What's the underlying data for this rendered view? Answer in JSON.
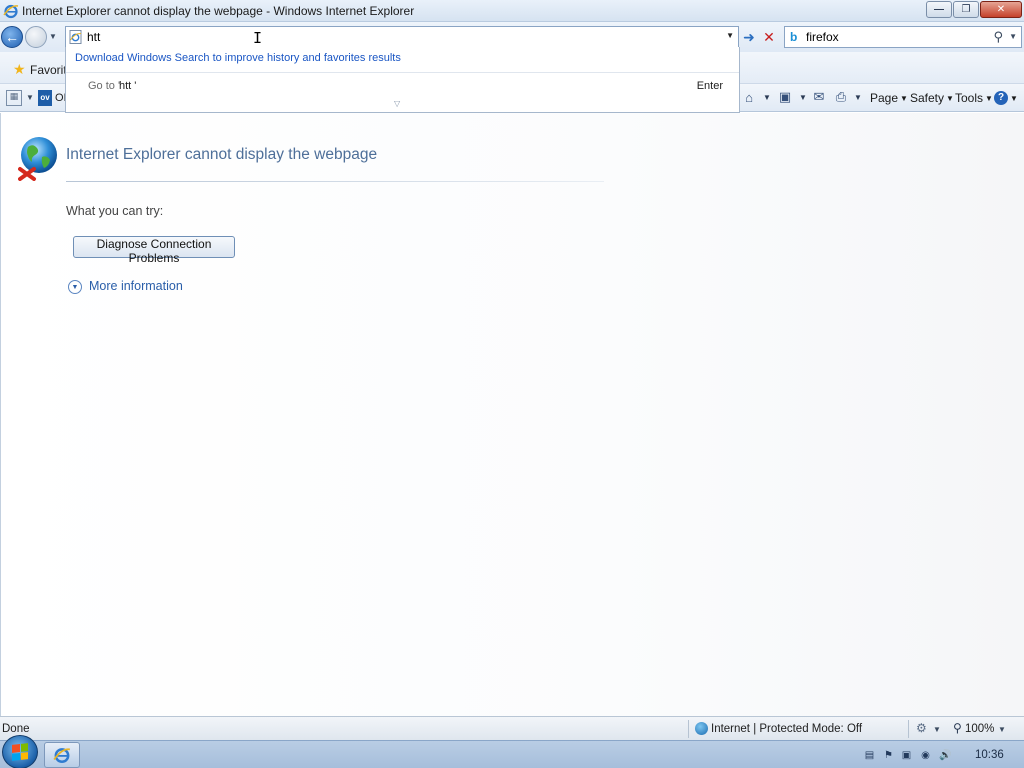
{
  "window": {
    "title": "Internet Explorer cannot display the webpage - Windows Internet Explorer"
  },
  "navbar": {
    "address_value": "htt",
    "search_value": "firefox"
  },
  "address_dropdown": {
    "suggestion_link": "Download Windows Search to improve history and favorites results",
    "goto_label": "Go to '",
    "goto_value": "htt '",
    "enter_label": "Enter"
  },
  "favorites_bar": {
    "label": "Favorite"
  },
  "tab": {
    "partial_title": "OI"
  },
  "command_bar": {
    "page_label": "Page",
    "safety_label": "Safety",
    "tools_label": "Tools"
  },
  "error_page": {
    "heading": "Internet Explorer cannot display the webpage",
    "try_label": "What you can try:",
    "diagnose_button": "Diagnose Connection Problems",
    "more_info": "More information"
  },
  "status_bar": {
    "status": "Done",
    "zone": "Internet | Protected Mode: Off",
    "zoom": "100%"
  },
  "taskbar": {
    "clock": "10:36"
  },
  "icons": {
    "back": "back-arrow-icon",
    "forward": "forward-arrow-icon",
    "go": "go-arrow-icon",
    "stop": "stop-x-icon",
    "search": "magnifier-icon",
    "favorites": "star-icon",
    "home": "home-icon",
    "feeds": "rss-feed-icon",
    "mail": "mail-icon",
    "print": "printer-icon",
    "help": "help-icon",
    "error_globe": "globe-error-icon",
    "start": "windows-start-icon"
  },
  "colors": {
    "heading_blue": "#4e6f99",
    "link_blue": "#2a5ea9",
    "suggestion_blue": "#1a56c4",
    "stop_red": "#c71e1e"
  }
}
